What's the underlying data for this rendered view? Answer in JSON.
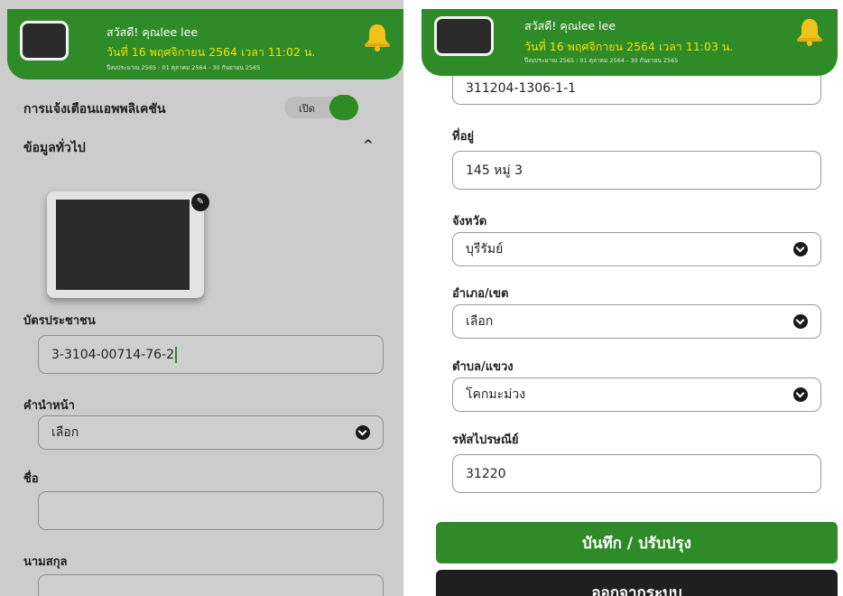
{
  "header": {
    "greeting": "สวัสดี! คุณlee lee",
    "fiscal_year": "ปีงบประมาณ 2565 : 01 ตุลาคม 2564 - 30 กันยายน 2565"
  },
  "left": {
    "header_date": "วันที่ 16 พฤศจิกายน 2564 เวลา 11:02 น.",
    "notification_label": "การแจ้งเตือนแอพพลิเคชัน",
    "toggle_text": "เปิด",
    "general_info": "ข้อมูลทั่วไป",
    "collapse_icon": "^",
    "edit_icon": "✎",
    "id_card_label": "บัตรประชาชน",
    "id_card_value": "3-3104-00714-76-2",
    "title_label": "คำนำหน้า",
    "title_value": "เลือก",
    "first_name_label": "ชื่อ",
    "first_name_value": "",
    "last_name_label": "นามสกุล",
    "last_name_value": ""
  },
  "right": {
    "header_date": "วันที่ 16 พฤศจิกายน 2564 เวลา 11:03 น.",
    "top_field_value": "311204-1306-1-1",
    "address_label": "ที่อยู่",
    "address_value": "145 หมู่ 3",
    "province_label": "จังหวัด",
    "province_value": "บุรีรัมย์",
    "district_label": "อำเภอ/เขต",
    "district_value": "เลือก",
    "subdistrict_label": "ตำบล/แขวง",
    "subdistrict_value": "โคกมะม่วง",
    "postal_label": "รหัสไปรษณีย์",
    "postal_value": "31220",
    "save_button": "บันทึก / ปรับปรุง",
    "logout_button": "ออกจากระบบ"
  },
  "colors": {
    "header_green": "#2e8b27",
    "date_yellow": "#f5e200",
    "bell_yellow": "#f2c21a",
    "logout_dark": "#1f1f1f"
  },
  "icons": [
    "avatar",
    "bell-icon",
    "chevron-up-icon",
    "pencil-icon",
    "dropdown-chevron-icon"
  ]
}
